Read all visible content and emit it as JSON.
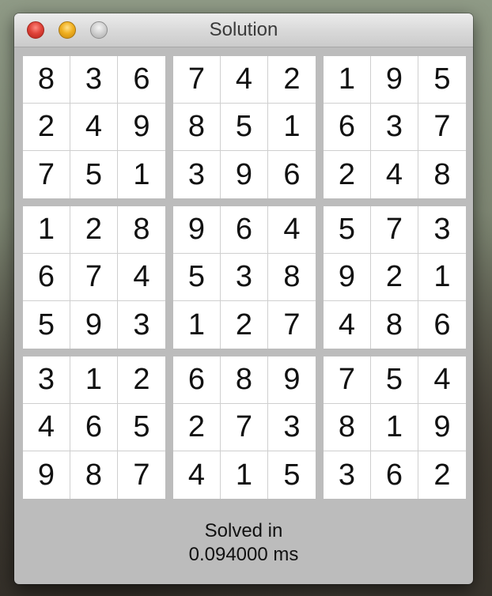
{
  "window": {
    "title": "Solution"
  },
  "icons": {
    "close": "close-window-icon",
    "minimize": "minimize-window-icon",
    "zoom": "zoom-window-icon"
  },
  "colors": {
    "close": "#e0443a",
    "minimize": "#f0b021",
    "zoom": "#cfcfcf",
    "window_bg": "#bcbcbc",
    "cell_bg": "#ffffff"
  },
  "sudoku": {
    "rows": [
      [
        "8",
        "3",
        "6",
        "7",
        "4",
        "2",
        "1",
        "9",
        "5"
      ],
      [
        "2",
        "4",
        "9",
        "8",
        "5",
        "1",
        "6",
        "3",
        "7"
      ],
      [
        "7",
        "5",
        "1",
        "3",
        "9",
        "6",
        "2",
        "4",
        "8"
      ],
      [
        "1",
        "2",
        "8",
        "9",
        "6",
        "4",
        "5",
        "7",
        "3"
      ],
      [
        "6",
        "7",
        "4",
        "5",
        "3",
        "8",
        "9",
        "2",
        "1"
      ],
      [
        "5",
        "9",
        "3",
        "1",
        "2",
        "7",
        "4",
        "8",
        "6"
      ],
      [
        "3",
        "1",
        "2",
        "6",
        "8",
        "9",
        "7",
        "5",
        "4"
      ],
      [
        "4",
        "6",
        "5",
        "2",
        "7",
        "3",
        "8",
        "1",
        "9"
      ],
      [
        "9",
        "8",
        "7",
        "4",
        "1",
        "5",
        "3",
        "6",
        "2"
      ]
    ]
  },
  "status": {
    "line1": "Solved in",
    "line2": "0.094000 ms"
  }
}
